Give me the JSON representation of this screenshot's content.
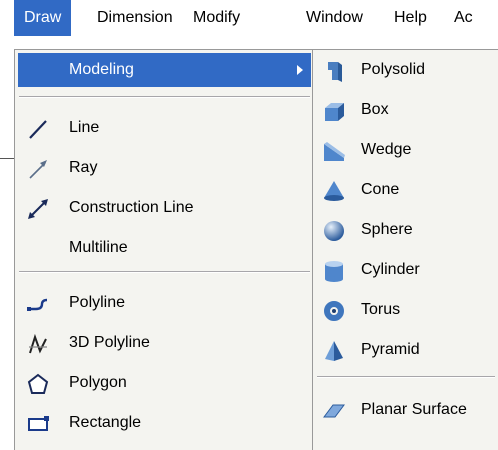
{
  "menubar": {
    "items": [
      {
        "label": "Draw",
        "icon": "",
        "active": true
      },
      {
        "label": "Dimension"
      },
      {
        "label": "Modify"
      },
      {
        "label": "Window"
      },
      {
        "label": "Help"
      },
      {
        "label": "Ac"
      }
    ]
  },
  "draw_menu": {
    "modeling": "Modeling",
    "line": "Line",
    "ray": "Ray",
    "construction_line": "Construction Line",
    "multiline": "Multiline",
    "polyline": "Polyline",
    "polyline_3d": "3D Polyline",
    "polygon": "Polygon",
    "rectangle": "Rectangle"
  },
  "modeling_menu": {
    "polysolid": "Polysolid",
    "box": "Box",
    "wedge": "Wedge",
    "cone": "Cone",
    "sphere": "Sphere",
    "cylinder": "Cylinder",
    "torus": "Torus",
    "pyramid": "Pyramid",
    "planar_surface": "Planar Surface"
  },
  "colors": {
    "highlight": "#316ac5",
    "menu_bg": "#f4f4f0"
  }
}
